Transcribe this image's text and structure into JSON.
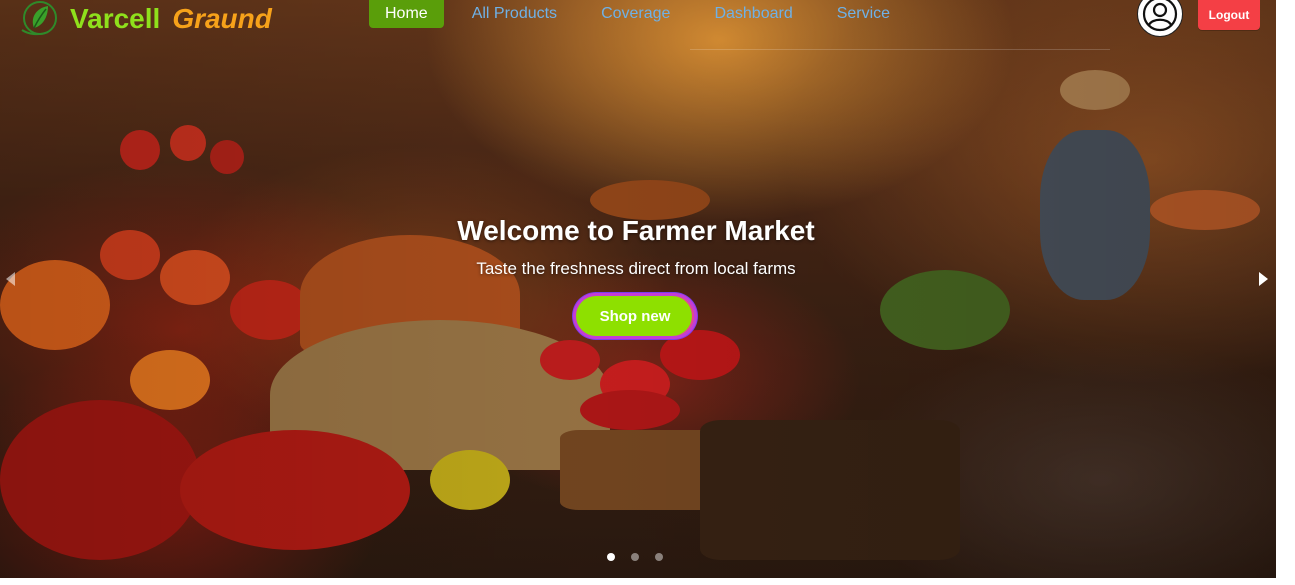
{
  "brand": {
    "name_part1": "Varcell",
    "name_part2": "Graund",
    "logo_icon": "leaf-globe-icon",
    "color_part1": "#8fe01c",
    "color_part2": "#f7a21a"
  },
  "nav": {
    "items": [
      {
        "label": "Home",
        "active": true
      },
      {
        "label": "All Products",
        "active": false
      },
      {
        "label": "Coverage",
        "active": false
      },
      {
        "label": "Dashboard",
        "active": false
      },
      {
        "label": "Service",
        "active": false
      }
    ],
    "active_color": "#5a9e0a",
    "link_color": "#6fb1e6"
  },
  "header": {
    "avatar_icon": "user-avatar-icon",
    "logout_label": "Logout",
    "logout_color": "#f43f45"
  },
  "hero": {
    "title": "Welcome to Farmer Market",
    "subtitle": "Taste the freshness direct from local farms",
    "cta_label": "Shop new",
    "cta_color": "#8ee000",
    "prev_icon": "chevron-left-icon",
    "next_icon": "chevron-right-icon",
    "slides_total": 3,
    "active_slide": 1
  }
}
